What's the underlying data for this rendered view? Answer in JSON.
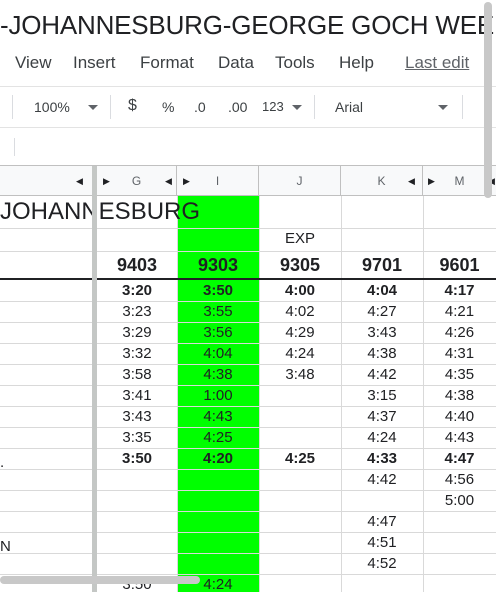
{
  "doc": {
    "title": "-JOHANNESBURG-GEORGE GOCH WEEK.Edi"
  },
  "menu": {
    "view": "View",
    "insert": "Insert",
    "format": "Format",
    "data": "Data",
    "tools": "Tools",
    "help": "Help",
    "last_edit": "Last edit"
  },
  "toolbar": {
    "zoom": "100%",
    "currency": "$",
    "percent": "%",
    "dec_less": ".0",
    "dec_more": ".00",
    "number_format": "123",
    "font": "Arial"
  },
  "columns": {
    "g": "G",
    "i": "I",
    "j": "J",
    "k": "K",
    "m": "M"
  },
  "sheet": {
    "heading": "JOHANNESBURG",
    "exp": "EXP",
    "trains": [
      "9403",
      "9303",
      "9305",
      "9701",
      "9601"
    ],
    "rows": [
      [
        "3:20",
        "3:50",
        "4:00",
        "4:04",
        "4:17"
      ],
      [
        "3:23",
        "3:55",
        "4:02",
        "4:27",
        "4:21"
      ],
      [
        "3:29",
        "3:56",
        "4:29",
        "3:43",
        "4:26"
      ],
      [
        "3:32",
        "4:04",
        "4:24",
        "4:38",
        "4:31"
      ],
      [
        "3:58",
        "4:38",
        "3:48",
        "4:42",
        "4:35"
      ],
      [
        "3:41",
        "1:00",
        "",
        "3:15",
        "4:38"
      ],
      [
        "3:43",
        "4:43",
        "",
        "4:37",
        "4:40"
      ],
      [
        "3:35",
        "4:25",
        "",
        "4:24",
        "4:43"
      ],
      [
        "3:50",
        "4:20",
        "4:25",
        "4:33",
        "4:47"
      ],
      [
        "",
        "",
        "",
        "4:42",
        "4:56"
      ],
      [
        "",
        "",
        "",
        "",
        "5:00"
      ],
      [
        "",
        "",
        "",
        "4:47",
        ""
      ],
      [
        "",
        "",
        "",
        "4:51",
        ""
      ],
      [
        "",
        "",
        "",
        "4:52",
        ""
      ],
      [
        "3:50",
        "4:24",
        "",
        "",
        ""
      ]
    ],
    "row_labels": {
      "r9": ".",
      "r13": "N"
    }
  }
}
